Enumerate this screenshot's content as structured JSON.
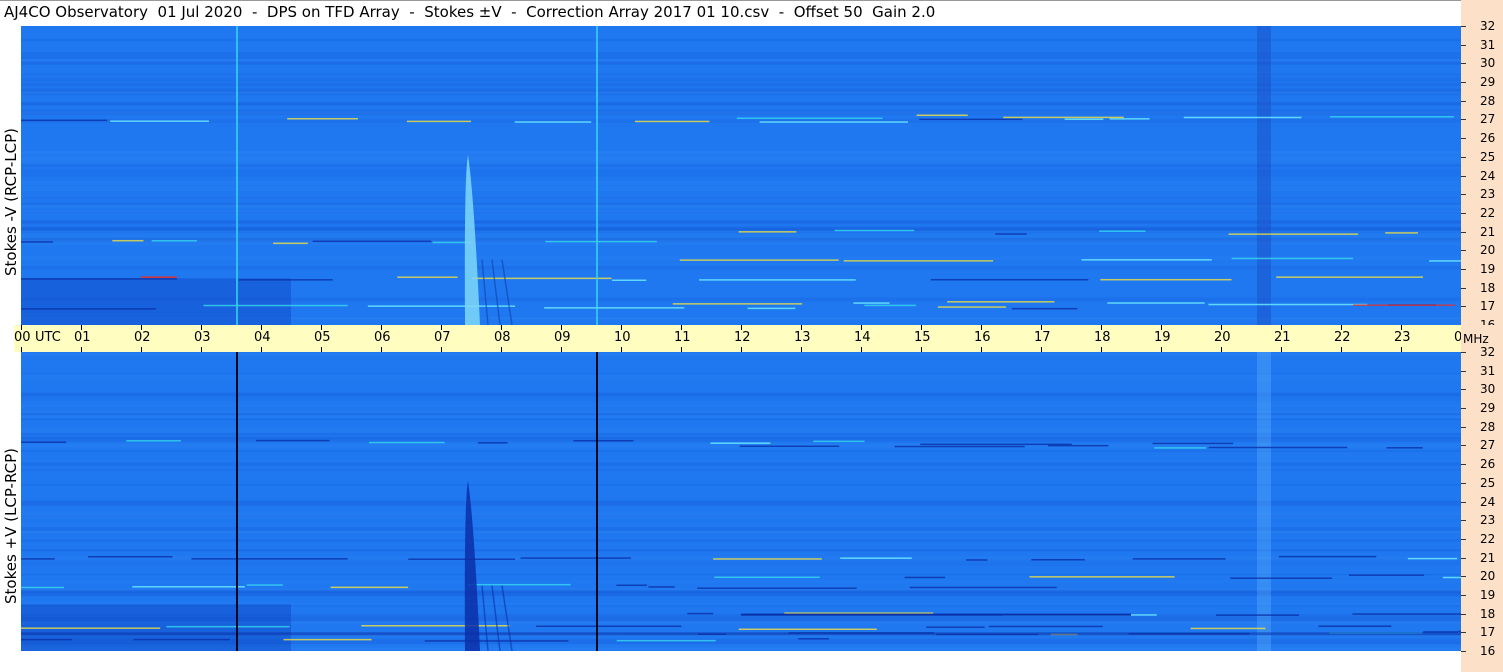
{
  "title": "AJ4CO Observatory  01 Jul 2020  -  DPS on TFD Array  -  Stokes ±V  -  Correction Array 2017 01 10.csv  -  Offset 50  Gain 2.0",
  "colors": {
    "background_blue": "#1f78f0",
    "dark_blue": "#0a2fa8",
    "cyan": "#36d8f0",
    "yellow": "#f0e040",
    "red": "#e03030",
    "timebar": "#fffec0",
    "scale_bg": "#fde0c8"
  },
  "chart_data": [
    {
      "type": "heatmap",
      "panel": "top",
      "ylabel": "Stokes -V (RCP-LCP)",
      "xlabel": "UTC",
      "xlim": [
        0,
        24
      ],
      "ylim": [
        16,
        32
      ],
      "yunit": "MHz",
      "yticks": [
        "16",
        "17",
        "18",
        "19",
        "20",
        "21",
        "22",
        "23",
        "24",
        "25",
        "26",
        "27",
        "28",
        "29",
        "30",
        "31",
        "32"
      ],
      "vertical_lines_utc": [
        3.6,
        9.6
      ],
      "burst_utc": 7.45,
      "interference_bands_mhz": [
        17.0,
        17.2,
        18.5,
        19.5,
        20.5,
        21.0,
        27.0,
        27.2
      ]
    },
    {
      "type": "heatmap",
      "panel": "bottom",
      "ylabel": "Stokes +V (LCP-RCP)",
      "xlabel": "UTC",
      "xlim": [
        0,
        24
      ],
      "ylim": [
        16,
        32
      ],
      "yunit": "MHz",
      "yticks": [
        "16",
        "17",
        "18",
        "19",
        "20",
        "21",
        "22",
        "23",
        "24",
        "25",
        "26",
        "27",
        "28",
        "29",
        "30",
        "31",
        "32"
      ],
      "vertical_lines_utc": [
        3.6,
        9.6
      ],
      "burst_utc": 7.45,
      "interference_bands_mhz": [
        16.6,
        17.0,
        17.3,
        18.0,
        19.5,
        20.0,
        21.0,
        27.0,
        27.2
      ]
    }
  ],
  "time_axis": {
    "first_label": "00",
    "utc_label": "UTC",
    "hours": [
      "01",
      "02",
      "03",
      "04",
      "05",
      "06",
      "07",
      "08",
      "09",
      "10",
      "11",
      "12",
      "13",
      "14",
      "15",
      "16",
      "17",
      "18",
      "19",
      "20",
      "21",
      "22",
      "23"
    ],
    "last_label": "00",
    "unit": "MHz"
  }
}
